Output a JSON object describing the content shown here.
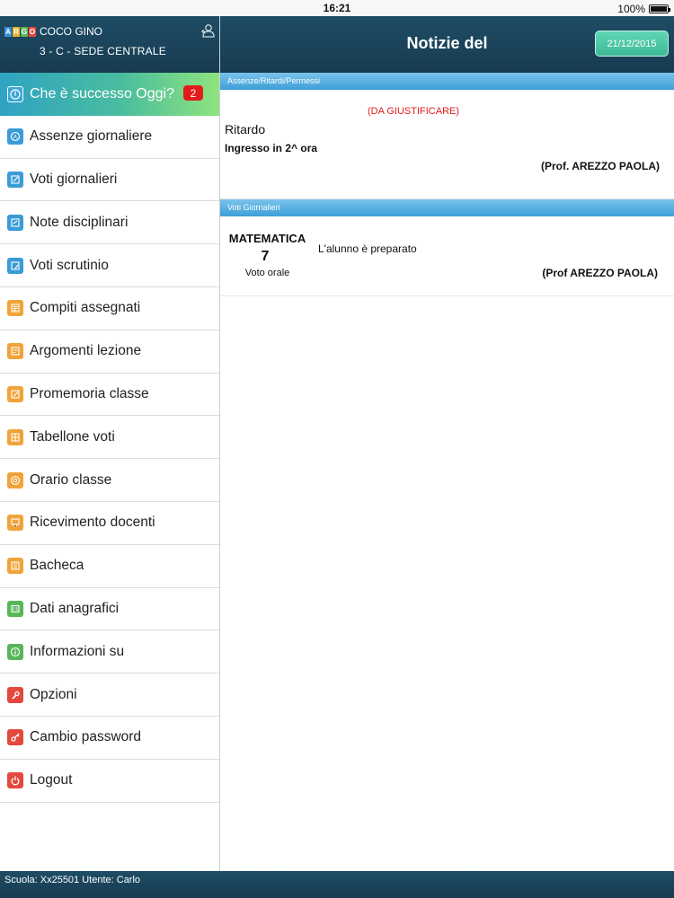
{
  "status_bar": {
    "time": "16:21",
    "battery": "100%"
  },
  "sidebar": {
    "logo_letters": [
      "A",
      "R",
      "G",
      "O"
    ],
    "logo_colors": [
      "#3b8fd6",
      "#e9b030",
      "#59b55a",
      "#e4493f"
    ],
    "user_name": "COCO GINO",
    "user_class": "3 - C - SEDE CENTRALE",
    "today": {
      "label": "Che è successo Oggi?",
      "badge": "2"
    },
    "items": [
      {
        "label": "Assenze giornaliere",
        "icon": "absence-icon",
        "color": "blue"
      },
      {
        "label": "Voti giornalieri",
        "icon": "grades-icon",
        "color": "blue"
      },
      {
        "label": "Note disciplinari",
        "icon": "notes-icon",
        "color": "blue"
      },
      {
        "label": "Voti scrutinio",
        "icon": "report-card-icon",
        "color": "blue"
      },
      {
        "label": "Compiti assegnati",
        "icon": "homework-icon",
        "color": "orange"
      },
      {
        "label": "Argomenti lezione",
        "icon": "lesson-topics-icon",
        "color": "orange"
      },
      {
        "label": "Promemoria classe",
        "icon": "reminder-icon",
        "color": "orange"
      },
      {
        "label": "Tabellone voti",
        "icon": "grid-icon",
        "color": "orange"
      },
      {
        "label": "Orario classe",
        "icon": "schedule-icon",
        "color": "orange"
      },
      {
        "label": "Ricevimento docenti",
        "icon": "teacher-meeting-icon",
        "color": "orange"
      },
      {
        "label": "Bacheca",
        "icon": "board-icon",
        "color": "orange"
      },
      {
        "label": "Dati anagrafici",
        "icon": "personal-data-icon",
        "color": "green"
      },
      {
        "label": "Informazioni su",
        "icon": "info-icon",
        "color": "green"
      },
      {
        "label": "Opzioni",
        "icon": "wrench-icon",
        "color": "red"
      },
      {
        "label": "Cambio password",
        "icon": "key-icon",
        "color": "red"
      },
      {
        "label": "Logout",
        "icon": "power-icon",
        "color": "red"
      }
    ]
  },
  "main": {
    "title": "Notizie del",
    "date": "21/12/2015",
    "absences": {
      "section_title": "Assenze/Ritardi/Permessi",
      "status": "(DA GIUSTIFICARE)",
      "type": "Ritardo",
      "detail": "Ingresso in 2^ ora",
      "teacher": "(Prof. AREZZO PAOLA)"
    },
    "grades": {
      "section_title": "Voti Giornalieri",
      "subject": "MATEMATICA",
      "value": "7",
      "kind": "Voto orale",
      "comment": "L'alunno è preparato",
      "teacher": "(Prof AREZZO PAOLA)"
    }
  },
  "footer": {
    "text": "Scuola: Xx25501 Utente: Carlo"
  }
}
